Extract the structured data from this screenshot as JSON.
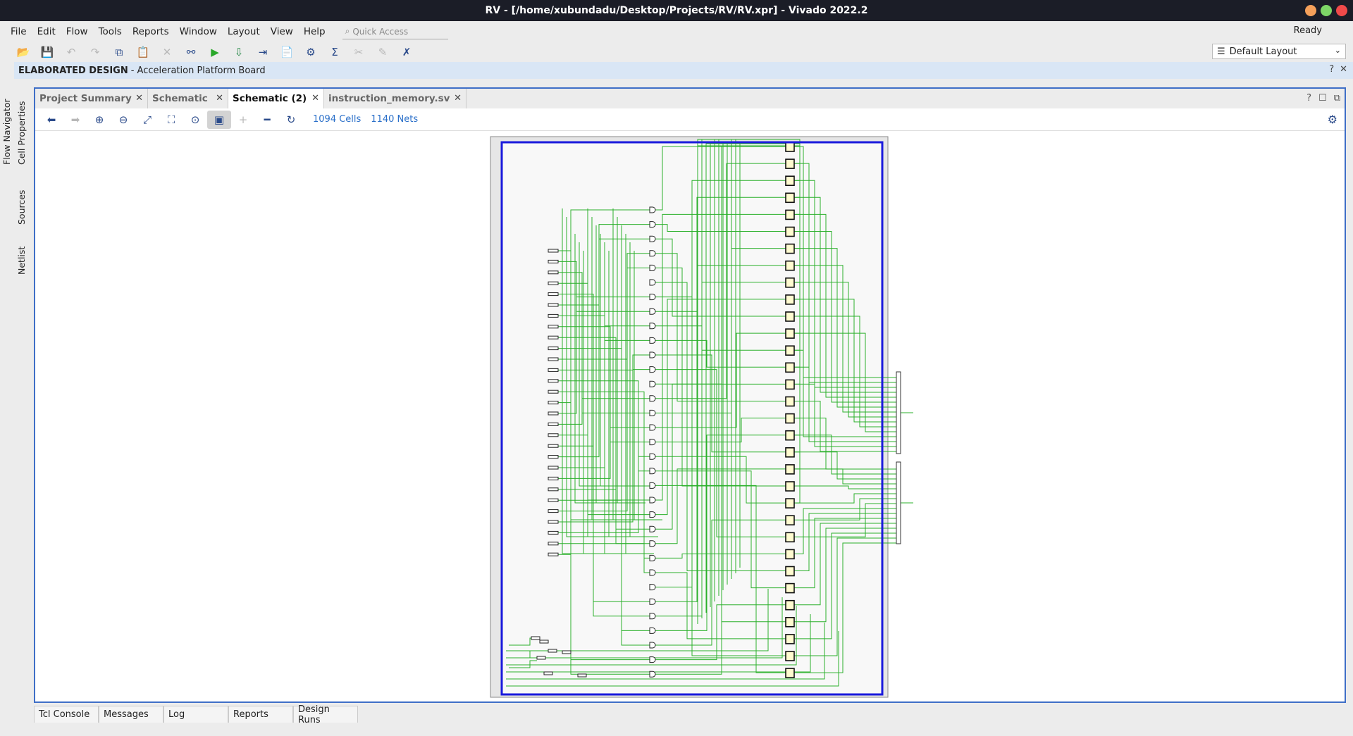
{
  "window": {
    "title": "RV - [/home/xubundadu/Desktop/Projects/RV/RV.xpr] - Vivado 2022.2",
    "controls": {
      "minimize_color": "#f5a05a",
      "maximize_color": "#7dd667",
      "close_color": "#f04a4a"
    }
  },
  "menu": {
    "items": [
      "File",
      "Edit",
      "Flow",
      "Tools",
      "Reports",
      "Window",
      "Layout",
      "View",
      "Help"
    ],
    "quick_access_placeholder": "Quick Access",
    "status": "Ready"
  },
  "toolbar": {
    "icons": [
      "open-project-icon",
      "save-icon",
      "undo-icon",
      "redo-icon",
      "copy-icon",
      "paste-icon",
      "delete-icon",
      "find-icon",
      "run-icon",
      "program-icon",
      "export-icon",
      "report-icon",
      "settings-icon",
      "sigma-icon",
      "disabled-tool-icon",
      "disabled-edit-icon",
      "cancel-run-icon"
    ]
  },
  "layout_select": {
    "value": "Default Layout"
  },
  "design_bar": {
    "title": "ELABORATED DESIGN",
    "subtitle": "- Acceleration Platform Board"
  },
  "side_tabs": [
    "Flow Navigator",
    "Cell Properties",
    "Sources",
    "Netlist"
  ],
  "tabs": [
    {
      "label": "Project Summary",
      "active": false
    },
    {
      "label": "Schematic",
      "active": false
    },
    {
      "label": "Schematic (2)",
      "active": true
    },
    {
      "label": "instruction_memory.sv",
      "active": false
    }
  ],
  "schematic_toolbar": {
    "cells": "1094 Cells",
    "nets": "1140 Nets"
  },
  "bottom_tabs": [
    "Tcl Console",
    "Messages",
    "Log",
    "Reports",
    "Design Runs"
  ],
  "colors": {
    "wire": "#2bb02b",
    "frame": "#1a1adc",
    "cell": "#fffbd0"
  }
}
